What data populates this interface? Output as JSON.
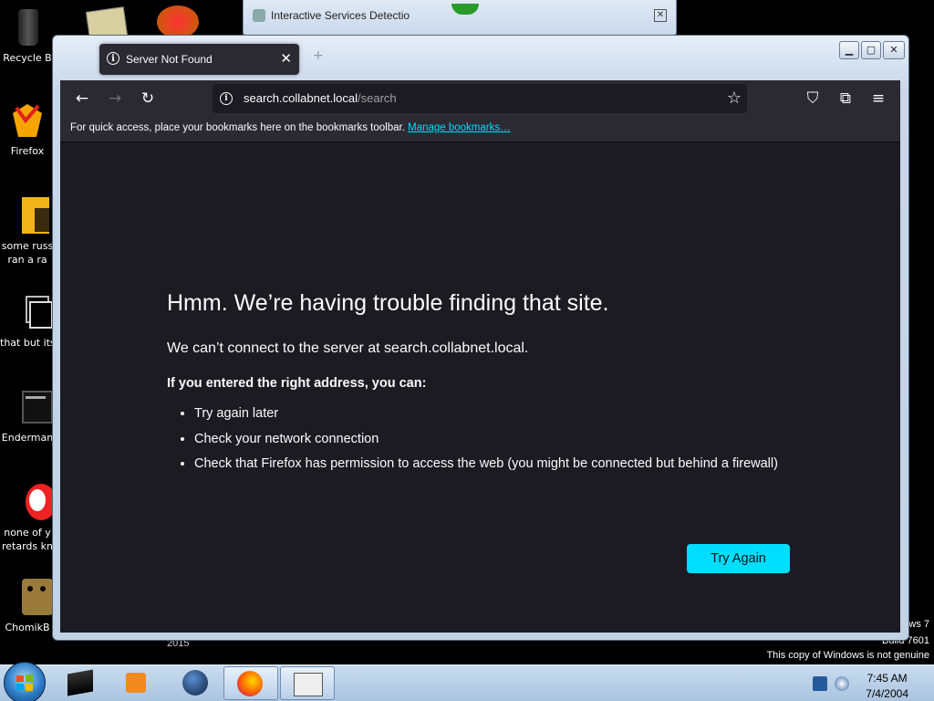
{
  "desktop": {
    "icons": [
      {
        "label": "Recycle B",
        "icon": "recycle-bin-icon"
      },
      {
        "label": "Firefox",
        "icon": "firefox-icon"
      },
      {
        "label": "some russ",
        "label2": "ran a ra",
        "icon": "folder-icon"
      },
      {
        "label": "that but its",
        "icon": "stack-icon"
      },
      {
        "label": "Enderman",
        "icon": "terminal-icon"
      },
      {
        "label": "none of y",
        "label2": "retards kn",
        "icon": "avatar-icon"
      },
      {
        "label": "ChomikB",
        "icon": "archive-icon"
      }
    ],
    "watermark": {
      "line1": "ws 7",
      "line2": "Build 7601",
      "line3": "This copy of Windows is not genuine"
    },
    "year_text": "2015"
  },
  "behind_window": {
    "title": "Interactive Services Detectio"
  },
  "browser": {
    "tab": {
      "title": "Server Not Found",
      "close": "✕"
    },
    "newtab": "+",
    "toolbar": {
      "back": "←",
      "forward": "→",
      "reload": "↻",
      "url_host": "search.collabnet.local",
      "url_path": "/search",
      "bookmark_star": "☆",
      "pocket": "⛉",
      "extensions": "⧉",
      "menu": "≡"
    },
    "bookmarks_bar": {
      "text": "For quick access, place your bookmarks here on the bookmarks toolbar.",
      "link": "Manage bookmarks…"
    },
    "window_controls": {
      "minimize": "▁",
      "maximize": "▢",
      "close": "✕"
    },
    "error": {
      "title": "Hmm. We’re having trouble finding that site.",
      "subtitle": "We can’t connect to the server at search.collabnet.local.",
      "hint": "If you entered the right address, you can:",
      "suggestions": [
        "Try again later",
        "Check your network connection",
        "Check that Firefox has permission to access the web (you might be connected but behind a firewall)"
      ],
      "button": "Try Again"
    }
  },
  "taskbar": {
    "time": "7:45 AM",
    "date": "7/4/2004"
  },
  "colors": {
    "accent": "#00ddff",
    "page_bg": "#1c1b22",
    "toolbar_bg": "#2b2a33",
    "text": "#fbfbfe"
  }
}
